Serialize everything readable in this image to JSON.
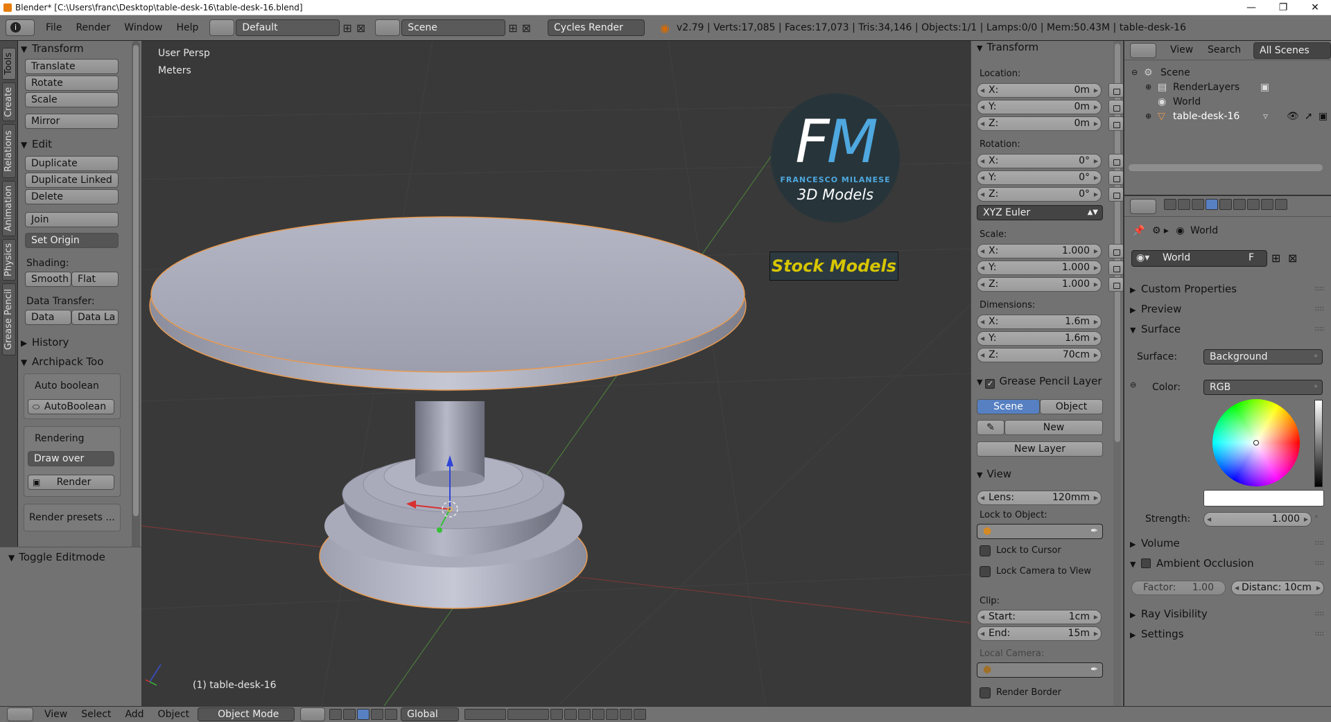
{
  "window": {
    "title": "Blender* [C:\\Users\\franc\\Desktop\\table-desk-16\\table-desk-16.blend]",
    "controls": [
      "—",
      "❐",
      "✕"
    ]
  },
  "topbar": {
    "menus": [
      "File",
      "Render",
      "Window",
      "Help"
    ],
    "layout": "Default",
    "scene": "Scene",
    "engine": "Cycles Render",
    "stats": "v2.79 | Verts:17,085 | Faces:17,073 | Tris:34,146 | Objects:1/1 | Lamps:0/0 | Mem:50.43M | table-desk-16"
  },
  "tabs": [
    "Tools",
    "Create",
    "Relations",
    "Animation",
    "Physics",
    "Grease Pencil"
  ],
  "toolshelf": {
    "transform_header": "Transform",
    "translate": "Translate",
    "rotate": "Rotate",
    "scale": "Scale",
    "mirror": "Mirror",
    "edit_header": "Edit",
    "duplicate": "Duplicate",
    "duplicate_linked": "Duplicate Linked",
    "delete": "Delete",
    "join": "Join",
    "set_origin": "Set Origin",
    "shading_label": "Shading:",
    "smooth": "Smooth",
    "flat": "Flat",
    "data_transfer_label": "Data Transfer:",
    "data": "Data",
    "data_la": "Data La",
    "history_header": "History",
    "archipack_header": "Archipack Too",
    "auto_boolean_label": "Auto boolean",
    "autoboolean_btn": "AutoBoolean",
    "rendering_label": "Rendering",
    "draw_over": "Draw over",
    "render_btn": "Render",
    "render_presets": "Render presets ...",
    "toggle_editmode": "Toggle Editmode"
  },
  "viewport": {
    "view_name": "User Persp",
    "units": "Meters",
    "object_label": "(1) table-desk-16",
    "logo": {
      "fm_f": "F",
      "fm_m": "M",
      "line1": "FRANCESCO MILANESE",
      "line2": "3D Models",
      "stock": "Stock Models"
    }
  },
  "npanel": {
    "transform_header": "Transform",
    "location_label": "Location:",
    "loc": [
      {
        "k": "X:",
        "v": "0m"
      },
      {
        "k": "Y:",
        "v": "0m"
      },
      {
        "k": "Z:",
        "v": "0m"
      }
    ],
    "rotation_label": "Rotation:",
    "rot": [
      {
        "k": "X:",
        "v": "0°"
      },
      {
        "k": "Y:",
        "v": "0°"
      },
      {
        "k": "Z:",
        "v": "0°"
      }
    ],
    "rotation_mode": "XYZ Euler",
    "scale_label": "Scale:",
    "scl": [
      {
        "k": "X:",
        "v": "1.000"
      },
      {
        "k": "Y:",
        "v": "1.000"
      },
      {
        "k": "Z:",
        "v": "1.000"
      }
    ],
    "dimensions_label": "Dimensions:",
    "dim": [
      {
        "k": "X:",
        "v": "1.6m"
      },
      {
        "k": "Y:",
        "v": "1.6m"
      },
      {
        "k": "Z:",
        "v": "70cm"
      }
    ],
    "gp_header": "Grease Pencil Layer",
    "gp_scene": "Scene",
    "gp_object": "Object",
    "gp_new": "New",
    "gp_new_layer": "New Layer",
    "view_header": "View",
    "lens_k": "Lens:",
    "lens_v": "120mm",
    "lock_obj_label": "Lock to Object:",
    "lock_cursor": "Lock to Cursor",
    "lock_camera": "Lock Camera to View",
    "clip_label": "Clip:",
    "clip_start_k": "Start:",
    "clip_start_v": "1cm",
    "clip_end_k": "End:",
    "clip_end_v": "15m",
    "local_camera": "Local Camera:",
    "render_border": "Render Border"
  },
  "outliner": {
    "view": "View",
    "search": "Search",
    "display": "All Scenes",
    "rows": [
      "Scene",
      "RenderLayers",
      "World",
      "table-desk-16"
    ]
  },
  "properties": {
    "crumb": "World",
    "world_name": "World",
    "fake_user": "F",
    "sections": {
      "custom_props": "Custom Properties",
      "preview": "Preview",
      "surface": "Surface",
      "volume": "Volume",
      "ao": "Ambient Occlusion",
      "ray_vis": "Ray Visibility",
      "settings": "Settings"
    },
    "surface_label": "Surface:",
    "surface_value": "Background",
    "color_label": "Color:",
    "color_mode": "RGB",
    "strength_label": "Strength:",
    "strength_value": "1.000",
    "factor_k": "Factor:",
    "factor_v": "1.00",
    "distance": "Distanc: 10cm"
  },
  "bottombar": {
    "menus": [
      "View",
      "Select",
      "Add",
      "Object"
    ],
    "mode": "Object Mode",
    "orientation": "Global"
  },
  "colors": {
    "accent": "#5680c2",
    "selection_outline": "#f0a050",
    "panel": "#727272",
    "viewport": "#393939"
  }
}
